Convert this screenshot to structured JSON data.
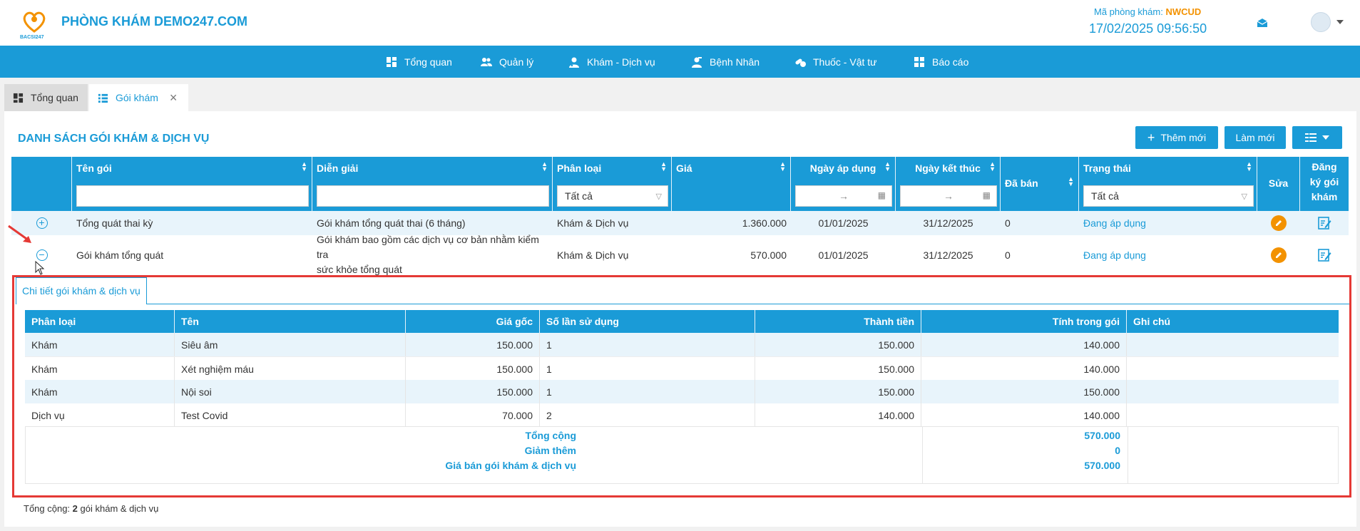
{
  "header": {
    "brand": "PHÒNG KHÁM DEMO247.COM",
    "logo_text": "BACSI247",
    "clinic_code_label": "Mã phòng khám:",
    "clinic_code": "NWCUD",
    "datetime": "17/02/2025 09:56:50"
  },
  "nav": [
    {
      "label": "Tổng quan",
      "icon": "dashboard-icon"
    },
    {
      "label": "Quản lý",
      "icon": "users-icon"
    },
    {
      "label": "Khám - Dịch vụ",
      "icon": "doctor-icon"
    },
    {
      "label": "Bệnh Nhân",
      "icon": "patient-icon"
    },
    {
      "label": "Thuốc - Vật tư",
      "icon": "medicine-icon"
    },
    {
      "label": "Báo cáo",
      "icon": "report-icon"
    }
  ],
  "tabs": {
    "overview": "Tổng quan",
    "packages": "Gói khám",
    "close": "×"
  },
  "panel": {
    "title": "DANH SÁCH GÓI KHÁM & DỊCH VỤ",
    "add_button": "Thêm mới",
    "refresh_button": "Làm mới"
  },
  "columns": {
    "name": "Tên gói",
    "description": "Diễn giải",
    "category": "Phân loại",
    "price": "Giá",
    "start_date": "Ngày áp dụng",
    "end_date": "Ngày kết thúc",
    "sold": "Đã bán",
    "status": "Trạng thái",
    "edit": "Sửa",
    "register_l1": "Đăng",
    "register_l2": "ký gói",
    "register_l3": "khám"
  },
  "filters": {
    "category": "Tất cả",
    "status": "Tất cả",
    "range_sep": "→"
  },
  "rows": [
    {
      "name": "Tổng quát thai kỳ",
      "description": "Gói khám tổng quát thai (6 tháng)",
      "description_l2": "",
      "category": "Khám & Dịch vụ",
      "price": "1.360.000",
      "start_date": "01/01/2025",
      "end_date": "31/12/2025",
      "sold": "0",
      "status": "Đang áp dụng",
      "toggle": "+"
    },
    {
      "name": "Gói khám tổng quát",
      "description": "Gói khám bao gồm các dịch vụ cơ bản nhằm kiểm tra",
      "description_l2": "sức khỏe tổng quát",
      "category": "Khám & Dịch vụ",
      "price": "570.000",
      "start_date": "01/01/2025",
      "end_date": "31/12/2025",
      "sold": "0",
      "status": "Đang áp dụng",
      "toggle": "−"
    }
  ],
  "detail": {
    "tab_label": "Chi tiết gói khám & dịch vụ",
    "columns": {
      "category": "Phân loại",
      "name": "Tên",
      "base_price": "Giá gốc",
      "uses": "Số lần sử dụng",
      "amount": "Thành tiền",
      "in_package": "Tính trong gói",
      "note": "Ghi chú"
    },
    "items": [
      {
        "category": "Khám",
        "name": "Siêu âm",
        "base_price": "150.000",
        "uses": "1",
        "amount": "150.000",
        "in_package": "140.000",
        "note": ""
      },
      {
        "category": "Khám",
        "name": "Xét nghiệm máu",
        "base_price": "150.000",
        "uses": "1",
        "amount": "150.000",
        "in_package": "140.000",
        "note": ""
      },
      {
        "category": "Khám",
        "name": "Nội soi",
        "base_price": "150.000",
        "uses": "1",
        "amount": "150.000",
        "in_package": "150.000",
        "note": ""
      },
      {
        "category": "Dịch vụ",
        "name": "Test Covid",
        "base_price": "70.000",
        "uses": "2",
        "amount": "140.000",
        "in_package": "140.000",
        "note": ""
      }
    ],
    "summary": {
      "total_label": "Tổng cộng",
      "total_value": "570.000",
      "discount_label": "Giảm thêm",
      "discount_value": "0",
      "sale_label": "Giá bán gói khám & dịch vụ",
      "sale_value": "570.000"
    }
  },
  "footer": {
    "total_prefix": "Tổng cộng:",
    "total_count": "2",
    "total_suffix": "gói khám & dịch vụ"
  },
  "colors": {
    "primary": "#1a9bd7",
    "accent": "#f39200",
    "highlight": "#e53935"
  }
}
